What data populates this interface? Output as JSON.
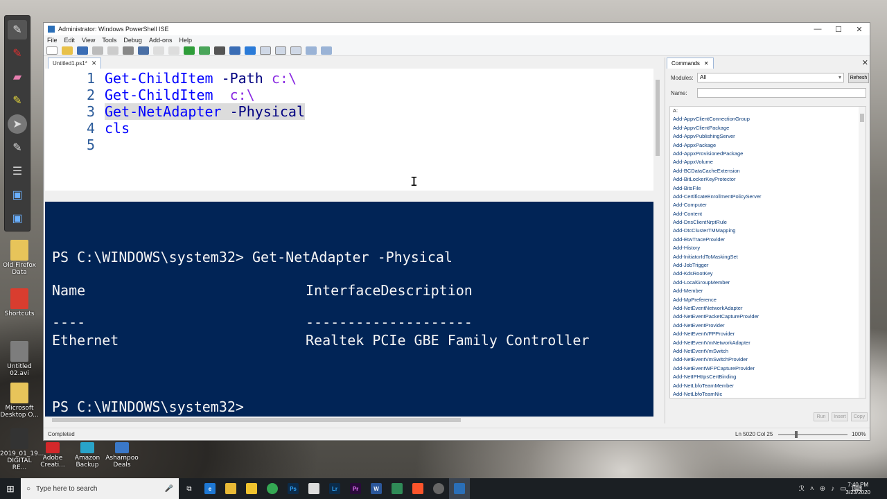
{
  "window": {
    "title": "Administrator: Windows PowerShell ISE"
  },
  "menu": [
    "File",
    "Edit",
    "View",
    "Tools",
    "Debug",
    "Add-ons",
    "Help"
  ],
  "editor": {
    "tab_label": "Untitled1.ps1*",
    "lines": [
      {
        "no": "1",
        "parts": [
          [
            "cmd",
            "Get-ChildItem"
          ],
          [
            "plain",
            " "
          ],
          [
            "param",
            "-Path"
          ],
          [
            "plain",
            " "
          ],
          [
            "str",
            "c:\\"
          ]
        ]
      },
      {
        "no": "2",
        "parts": [
          [
            "cmd",
            "Get-ChildItem"
          ],
          [
            "plain",
            "  "
          ],
          [
            "str",
            "c:\\"
          ]
        ]
      },
      {
        "no": "3",
        "parts": [
          [
            "cmdsel",
            "Get-NetAdapter"
          ],
          [
            "sel",
            " "
          ],
          [
            "paramsel",
            "-Physical"
          ]
        ]
      },
      {
        "no": "4",
        "parts": [
          [
            "cmd",
            "cls"
          ]
        ]
      },
      {
        "no": "5",
        "parts": []
      }
    ]
  },
  "console": {
    "prompt_command": "PS C:\\WINDOWS\\system32> Get-NetAdapter -Physical",
    "header_name": "Name",
    "header_desc": "InterfaceDescription",
    "sep_name": "----",
    "sep_desc": "--------------------",
    "row_name": "Ethernet",
    "row_desc": "Realtek PCIe GBE Family Controller",
    "final_prompt": "PS C:\\WINDOWS\\system32>"
  },
  "commands_panel": {
    "tab_label": "Commands",
    "modules_label": "Modules:",
    "modules_value": "All",
    "refresh_label": "Refresh",
    "name_label": "Name:",
    "items": [
      "A:",
      "Add-AppvClientConnectionGroup",
      "Add-AppvClientPackage",
      "Add-AppvPublishingServer",
      "Add-AppxPackage",
      "Add-AppxProvisionedPackage",
      "Add-AppxVolume",
      "Add-BCDataCacheExtension",
      "Add-BitLockerKeyProtector",
      "Add-BitsFile",
      "Add-CertificateEnrollmentPolicyServer",
      "Add-Computer",
      "Add-Content",
      "Add-DnsClientNrptRule",
      "Add-DtcClusterTMMapping",
      "Add-EtwTraceProvider",
      "Add-History",
      "Add-InitiatorIdToMaskingSet",
      "Add-JobTrigger",
      "Add-KdsRootKey",
      "Add-LocalGroupMember",
      "Add-Member",
      "Add-MpPreference",
      "Add-NetEventNetworkAdapter",
      "Add-NetEventPacketCaptureProvider",
      "Add-NetEventProvider",
      "Add-NetEventVFPProvider",
      "Add-NetEventVmNetworkAdapter",
      "Add-NetEventVmSwitch",
      "Add-NetEventVmSwitchProvider",
      "Add-NetEventWFPCaptureProvider",
      "Add-NetIPHttpsCertBinding",
      "Add-NetLbfoTeamMember",
      "Add-NetLbfoTeamNic"
    ],
    "run_label": "Run",
    "insert_label": "Insert",
    "copy_label": "Copy"
  },
  "status": {
    "text": "Completed",
    "cursor": "Ln 5020  Col 25",
    "zoom": "100%"
  },
  "desktop_icons": [
    {
      "label": "Old Firefox Data"
    },
    {
      "label": "Shortcuts"
    },
    {
      "label": "Untitled 02.avi"
    },
    {
      "label": "Microsoft Desktop O..."
    },
    {
      "label": "2019_01_19... DIGITAL RE..."
    },
    {
      "label": "Adobe Creati..."
    },
    {
      "label": "Amazon Backup"
    },
    {
      "label": "Ashampoo Deals"
    }
  ],
  "taskbar": {
    "search_placeholder": "Type here to search",
    "clock_time": "7:40 PM",
    "clock_date": "3/23/2020"
  },
  "colors": {
    "console_bg": "#012456",
    "cmdlet": "#0000ff",
    "parameter": "#000080",
    "string": "#8a2be2"
  }
}
